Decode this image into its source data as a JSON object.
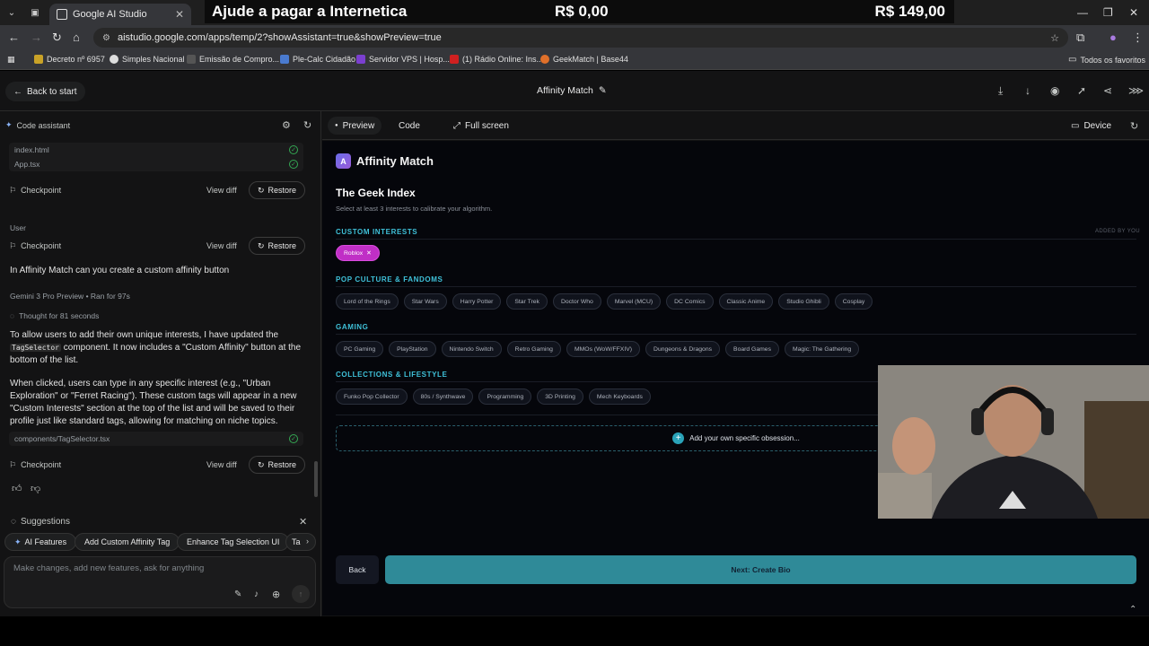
{
  "browser": {
    "active_tab": "Google AI Studio",
    "url": "aistudio.google.com/apps/temp/2?showAssistant=true&showPreview=true",
    "bookmarks": [
      "Decreto nº 6957",
      "Simples Nacional",
      "Emissão de Compro...",
      "Ple-Calc Cidadão",
      "Servidor VPS | Hosp...",
      "(1) Rádio Online: Ins...",
      "GeekMatch | Base44"
    ],
    "all_bookmarks": "Todos os favoritos"
  },
  "donation": {
    "title": "Ajude a pagar a Internetica",
    "current": "R$ 0,00",
    "goal": "R$ 149,00"
  },
  "studio": {
    "back_label": "Back to start",
    "project_title": "Affinity Match",
    "code_assistant": "Code assistant",
    "files": [
      {
        "name": "index.html"
      },
      {
        "name": "App.tsx"
      }
    ],
    "checkpoint": "Checkpoint",
    "view_diff": "View diff",
    "restore": "Restore",
    "user_label": "User",
    "user_message": "In Affinity Match can you create a custom affinity button",
    "model": "Gemini 3 Pro Preview",
    "ran_for": "Ran for 97s",
    "thought": "Thought for 81 seconds",
    "reply_p1_a": "To allow users to add their own unique interests, I have updated the",
    "reply_code": "TagSelector",
    "reply_p1_b": "component. It now includes a \"Custom Affinity\" button at the bottom of the list.",
    "reply_p2": "When clicked, users can type in any specific interest (e.g., \"Urban Exploration\" or \"Ferret Racing\"). These custom tags will appear in a new \"Custom Interests\" section at the top of the list and will be saved to their profile just like standard tags, allowing for matching on niche topics.",
    "changed_file": "components/TagSelector.tsx",
    "suggestions_label": "Suggestions",
    "suggestions": [
      "AI Features",
      "Add Custom Affinity Tag",
      "Enhance Tag Selection UI",
      "Ta"
    ],
    "prompt_placeholder": "Make changes, add new features, ask for anything",
    "tabs": {
      "preview": "Preview",
      "code": "Code",
      "fullscreen": "Full screen",
      "device": "Device"
    }
  },
  "app": {
    "logo_letter": "A",
    "name": "Affinity Match",
    "heading": "The Geek Index",
    "subheading": "Select at least 3 interests to calibrate your algorithm.",
    "added_note": "ADDED BY YOU",
    "sections": {
      "custom": {
        "title": "CUSTOM INTERESTS",
        "tags": [
          "Roblox"
        ]
      },
      "pop": {
        "title": "POP CULTURE & FANDOMS",
        "tags": [
          "Lord of the Rings",
          "Star Wars",
          "Harry Potter",
          "Star Trek",
          "Doctor Who",
          "Marvel (MCU)",
          "DC Comics",
          "Classic Anime",
          "Studio Ghibli",
          "Cosplay"
        ]
      },
      "gaming": {
        "title": "GAMING",
        "tags": [
          "PC Gaming",
          "PlayStation",
          "Nintendo Switch",
          "Retro Gaming",
          "MMOs (WoW/FFXIV)",
          "Dungeons & Dragons",
          "Board Games",
          "Magic: The Gathering"
        ]
      },
      "collections": {
        "title": "COLLECTIONS & LIFESTYLE",
        "tags": [
          "Funko Pop Collector",
          "80s / Synthwave",
          "Programming",
          "3D Printing",
          "Mech Keyboards"
        ]
      }
    },
    "add_obsession": "Add your own specific obsession...",
    "back": "Back",
    "next": "Next: Create Bio"
  }
}
